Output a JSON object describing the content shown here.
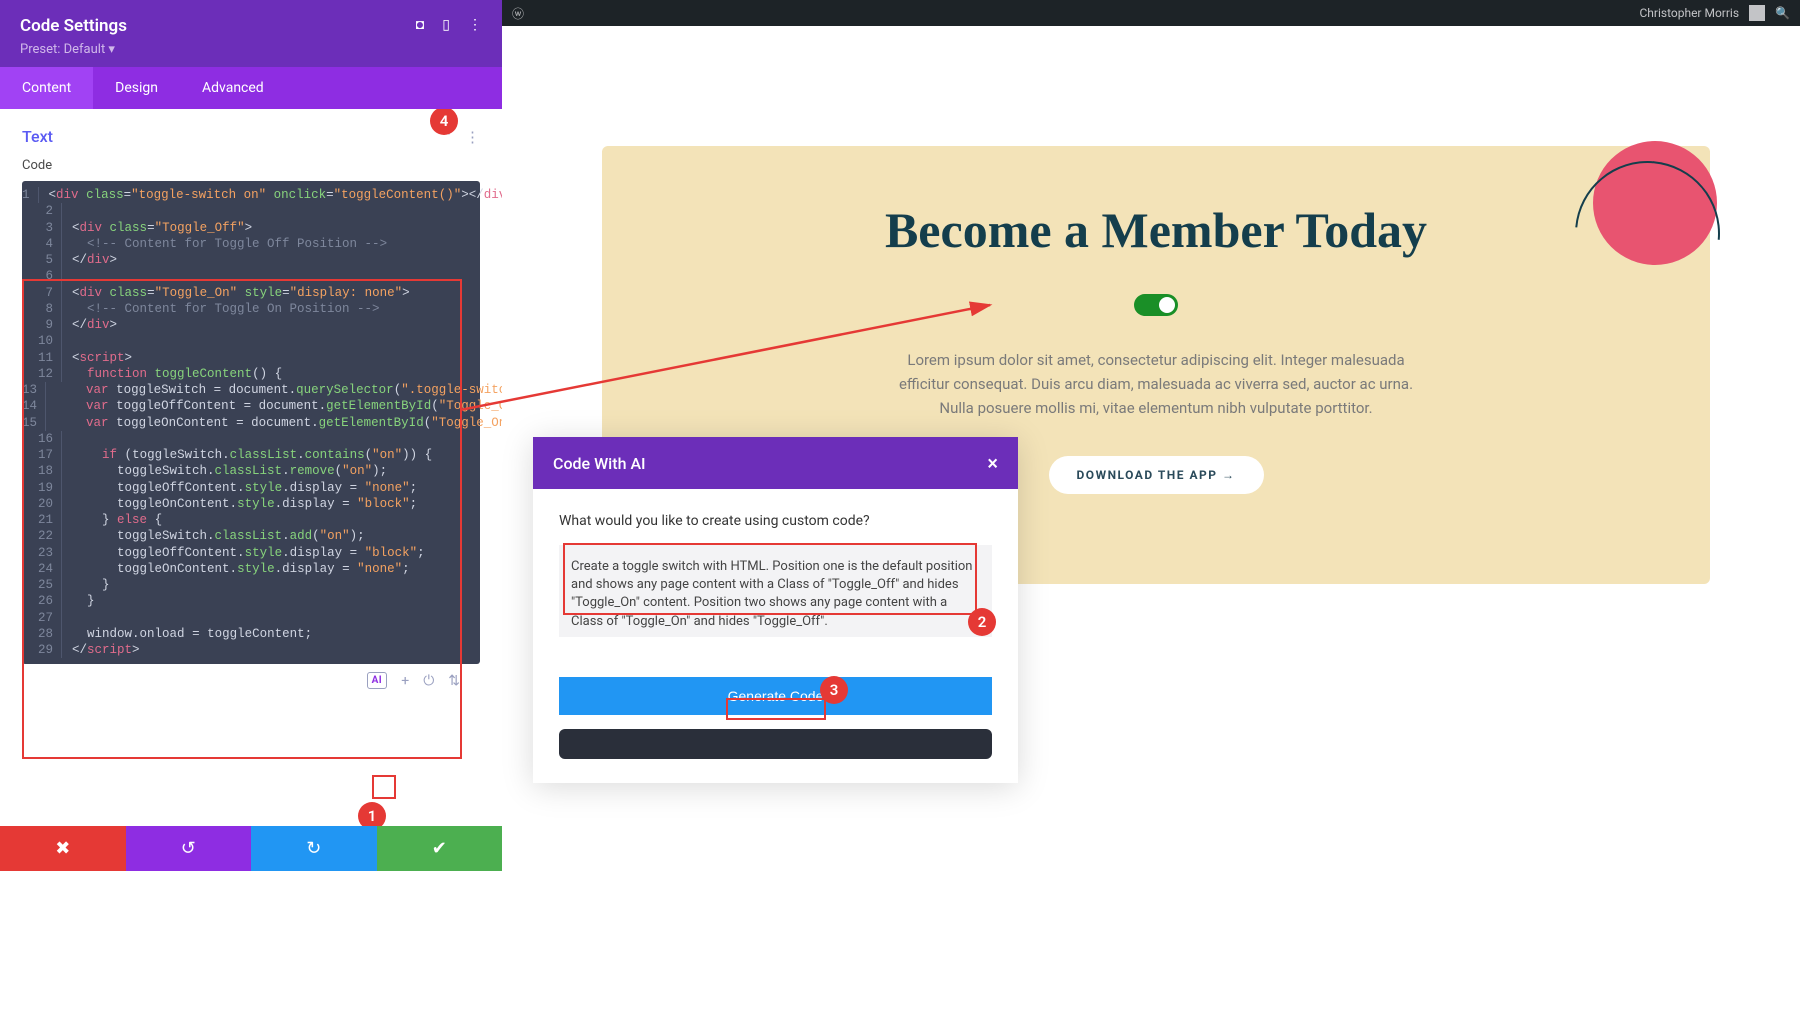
{
  "panel": {
    "title": "Code Settings",
    "preset": "Preset: Default ▾",
    "tabs": {
      "content": "Content",
      "design": "Design",
      "advanced": "Advanced"
    },
    "section": "Text",
    "code_label": "Code"
  },
  "code": {
    "lines": [
      {
        "n": "1",
        "html": "<span class='punct'>&lt;</span><span class='tag-color'>div</span> <span class='attr-name'>class</span><span class='punct'>=</span><span class='attr-val'>\"toggle-switch on\"</span> <span class='attr-name'>onclick</span><span class='punct'>=</span><span class='attr-val'>\"toggleContent()\"</span><span class='punct'>&gt;&lt;/</span><span class='tag-color'>div</span><span class='punct'>&gt;</span>"
      },
      {
        "n": "2",
        "html": ""
      },
      {
        "n": "3",
        "html": "<span class='punct'>&lt;</span><span class='tag-color'>div</span> <span class='attr-name'>class</span><span class='punct'>=</span><span class='attr-val'>\"Toggle_Off\"</span><span class='punct'>&gt;</span>"
      },
      {
        "n": "4",
        "html": "  <span class='comment'>&lt;!-- Content for Toggle Off Position --&gt;</span>"
      },
      {
        "n": "5",
        "html": "<span class='punct'>&lt;/</span><span class='tag-color'>div</span><span class='punct'>&gt;</span>"
      },
      {
        "n": "6",
        "html": ""
      },
      {
        "n": "7",
        "html": "<span class='punct'>&lt;</span><span class='tag-color'>div</span> <span class='attr-name'>class</span><span class='punct'>=</span><span class='attr-val'>\"Toggle_On\"</span> <span class='attr-name'>style</span><span class='punct'>=</span><span class='attr-val'>\"display: none\"</span><span class='punct'>&gt;</span>"
      },
      {
        "n": "8",
        "html": "  <span class='comment'>&lt;!-- Content for Toggle On Position --&gt;</span>"
      },
      {
        "n": "9",
        "html": "<span class='punct'>&lt;/</span><span class='tag-color'>div</span><span class='punct'>&gt;</span>"
      },
      {
        "n": "10",
        "html": ""
      },
      {
        "n": "11",
        "html": "<span class='punct'>&lt;</span><span class='tag-color'>script</span><span class='punct'>&gt;</span>"
      },
      {
        "n": "12",
        "html": "  <span class='keyword'>function</span> <span class='func-name'>toggleContent</span><span class='punct'>() {</span>"
      },
      {
        "n": "13",
        "html": "    <span class='keyword'>var</span> <span class='num-lit'>toggleSwitch</span> <span class='punct'>=</span> <span class='num-lit'>document</span><span class='punct'>.</span><span class='func-name'>querySelector</span><span class='punct'>(</span><span class='string'>\".toggle-switch\"</span><span class='punct'>);</span>"
      },
      {
        "n": "14",
        "html": "    <span class='keyword'>var</span> <span class='num-lit'>toggleOffContent</span> <span class='punct'>=</span> <span class='num-lit'>document</span><span class='punct'>.</span><span class='func-name'>getElementById</span><span class='punct'>(</span><span class='string'>\"Toggle_Off\"</span><span class='punct'>);</span>"
      },
      {
        "n": "15",
        "html": "    <span class='keyword'>var</span> <span class='num-lit'>toggleOnContent</span> <span class='punct'>=</span> <span class='num-lit'>document</span><span class='punct'>.</span><span class='func-name'>getElementById</span><span class='punct'>(</span><span class='string'>\"Toggle_On\"</span><span class='punct'>);</span>"
      },
      {
        "n": "16",
        "html": ""
      },
      {
        "n": "17",
        "html": "    <span class='keyword'>if</span> <span class='punct'>(</span><span class='num-lit'>toggleSwitch</span><span class='punct'>.</span><span class='func-name'>classList</span><span class='punct'>.</span><span class='func-name'>contains</span><span class='punct'>(</span><span class='string'>\"on\"</span><span class='punct'>)) {</span>"
      },
      {
        "n": "18",
        "html": "      <span class='num-lit'>toggleSwitch</span><span class='punct'>.</span><span class='func-name'>classList</span><span class='punct'>.</span><span class='func-name'>remove</span><span class='punct'>(</span><span class='string'>\"on\"</span><span class='punct'>);</span>"
      },
      {
        "n": "19",
        "html": "      <span class='num-lit'>toggleOffContent</span><span class='punct'>.</span><span class='func-name'>style</span><span class='punct'>.</span><span class='num-lit'>display</span> <span class='punct'>=</span> <span class='string'>\"none\"</span><span class='punct'>;</span>"
      },
      {
        "n": "20",
        "html": "      <span class='num-lit'>toggleOnContent</span><span class='punct'>.</span><span class='func-name'>style</span><span class='punct'>.</span><span class='num-lit'>display</span> <span class='punct'>=</span> <span class='string'>\"block\"</span><span class='punct'>;</span>"
      },
      {
        "n": "21",
        "html": "    <span class='punct'>}</span> <span class='keyword'>else</span> <span class='punct'>{</span>"
      },
      {
        "n": "22",
        "html": "      <span class='num-lit'>toggleSwitch</span><span class='punct'>.</span><span class='func-name'>classList</span><span class='punct'>.</span><span class='func-name'>add</span><span class='punct'>(</span><span class='string'>\"on\"</span><span class='punct'>);</span>"
      },
      {
        "n": "23",
        "html": "      <span class='num-lit'>toggleOffContent</span><span class='punct'>.</span><span class='func-name'>style</span><span class='punct'>.</span><span class='num-lit'>display</span> <span class='punct'>=</span> <span class='string'>\"block\"</span><span class='punct'>;</span>"
      },
      {
        "n": "24",
        "html": "      <span class='num-lit'>toggleOnContent</span><span class='punct'>.</span><span class='func-name'>style</span><span class='punct'>.</span><span class='num-lit'>display</span> <span class='punct'>=</span> <span class='string'>\"none\"</span><span class='punct'>;</span>"
      },
      {
        "n": "25",
        "html": "    <span class='punct'>}</span>"
      },
      {
        "n": "26",
        "html": "  <span class='punct'>}</span>"
      },
      {
        "n": "27",
        "html": ""
      },
      {
        "n": "28",
        "html": "  <span class='num-lit'>window</span><span class='punct'>.</span><span class='num-lit'>onload</span> <span class='punct'>=</span> <span class='num-lit'>toggleContent</span><span class='punct'>;</span>"
      },
      {
        "n": "29",
        "html": "<span class='punct'>&lt;/</span><span class='tag-color'>script</span><span class='punct'>&gt;</span>"
      }
    ],
    "ai_label": "AI"
  },
  "wp": {
    "user": "Christopher Morris"
  },
  "hero": {
    "title": "Become a Member Today",
    "text": "Lorem ipsum dolor sit amet, consectetur adipiscing elit. Integer malesuada efficitur consequat. Duis arcu diam, malesuada ac viverra sed, auctor ac urna. Nulla posuere mollis mi, vitae elementum nibh vulputate porttitor.",
    "btn": "DOWNLOAD THE APP →"
  },
  "ai_modal": {
    "title": "Code With AI",
    "question": "What would you like to create using custom code?",
    "prompt": "Create a toggle switch with HTML. Position one is the default position and shows any page content with a Class of \"Toggle_Off\" and hides \"Toggle_On\" content. Position two shows any page content with a Class of \"Toggle_On\" and hides \"Toggle_Off\".",
    "generate": "Generate Code"
  },
  "badges": {
    "b1": "1",
    "b2": "2",
    "b3": "3",
    "b4": "4"
  },
  "colors": {
    "accent": "#8e2de2",
    "danger": "#e53935"
  }
}
